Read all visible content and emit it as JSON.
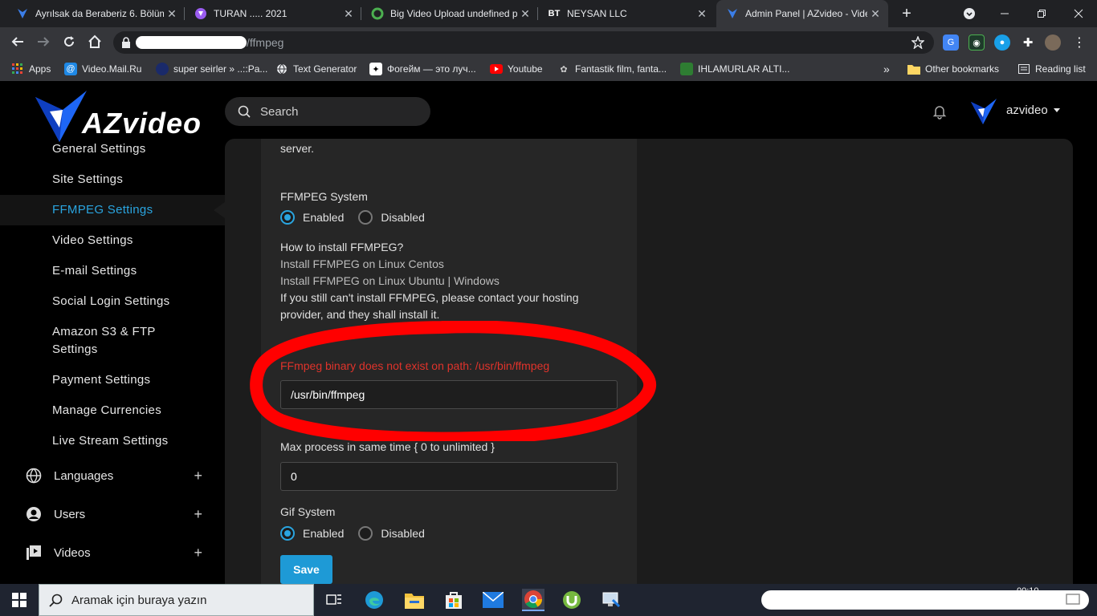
{
  "browser": {
    "tabs": [
      {
        "title": "Ayrılsak da Beraberiz 6. Bölüm",
        "favicon": "azvideo-logo-icon",
        "color": "#3b7ee8"
      },
      {
        "title": "TURAN ..... 2021",
        "favicon": "turan-logo-icon",
        "color": "#9a5cf0"
      },
      {
        "title": "Big Video Upload undefined p",
        "favicon": "forum-logo-icon",
        "color": "#4caf50"
      },
      {
        "title": "NEYSAN LLC",
        "favicon": "bt-logo-icon",
        "favicon_text": "BT",
        "color": "#ffffff"
      },
      {
        "title": "Admin Panel | AZvideo - Vide",
        "favicon": "azvideo-logo-icon",
        "color": "#3b7ee8",
        "active": true
      }
    ],
    "new_tab": "+",
    "address_path": "/ffmpeg",
    "bookmarks": [
      {
        "label": "Apps",
        "icon": "apps-grid-icon"
      },
      {
        "label": "Video.Mail.Ru",
        "icon": "mailru-icon"
      },
      {
        "label": "super seirler » ..::Pa...",
        "icon": "globe-dark-icon"
      },
      {
        "label": "Text Generator",
        "icon": "globe-icon"
      },
      {
        "label": "Фогейм — это луч...",
        "icon": "puzzle-icon"
      },
      {
        "label": "Youtube",
        "icon": "youtube-icon"
      },
      {
        "label": "Fantastik film, fanta...",
        "icon": "film-icon"
      },
      {
        "label": "IHLAMURLAR ALTI...",
        "icon": "green-icon"
      }
    ],
    "bookmarks_more": "»",
    "other_bookmarks": "Other bookmarks",
    "reading_list": "Reading list"
  },
  "app": {
    "logo_text": "AZvideo",
    "search_placeholder": "Search",
    "username": "azvideo"
  },
  "sidebar": {
    "settings_items": [
      {
        "label": "General Settings"
      },
      {
        "label": "Site Settings"
      },
      {
        "label": "FFMPEG Settings",
        "active": true
      },
      {
        "label": "Video Settings"
      },
      {
        "label": "E-mail Settings"
      },
      {
        "label": "Social Login Settings"
      },
      {
        "label": "Amazon S3 & FTP Settings"
      },
      {
        "label": "Payment Settings"
      },
      {
        "label": "Manage Currencies"
      },
      {
        "label": "Live Stream Settings"
      }
    ],
    "sections": [
      {
        "label": "Languages",
        "icon": "globe-icon",
        "expand": "+"
      },
      {
        "label": "Users",
        "icon": "user-circle-icon",
        "expand": "+"
      },
      {
        "label": "Videos",
        "icon": "video-library-icon",
        "expand": "+"
      }
    ]
  },
  "form": {
    "top_text": "server.",
    "ffmpeg_system_label": "FFMPEG System",
    "ffmpeg_system": {
      "enabled_label": "Enabled",
      "disabled_label": "Disabled",
      "selected": "Enabled"
    },
    "how_to_title": "How to install FFMPEG?",
    "how_to_centos": "Install FFMPEG on Linux Centos",
    "how_to_ubuntu": "Install FFMPEG on Linux Ubuntu | Windows",
    "help_text_1": "If you still can't install FFMPEG, please contact your hosting",
    "help_text_2": "provider, and they shall install it.",
    "error_text": "FFmpeg binary does not exist on path: /usr/bin/ffmpeg",
    "ffmpeg_path_value": "/usr/bin/ffmpeg",
    "max_process_label": "Max process in same time { 0 to unlimited }",
    "max_process_value": "0",
    "gif_system_label": "Gif System",
    "gif_system": {
      "enabled_label": "Enabled",
      "disabled_label": "Disabled",
      "selected": "Enabled"
    },
    "save_label": "Save"
  },
  "taskbar": {
    "search_placeholder": "Aramak için buraya yazın",
    "time": "00:10"
  },
  "colors": {
    "accent": "#2aa5e0",
    "error": "#e0332b",
    "annotation": "#ff0000",
    "background": "#000000",
    "panel": "#1c1c1c",
    "card": "#262626"
  }
}
